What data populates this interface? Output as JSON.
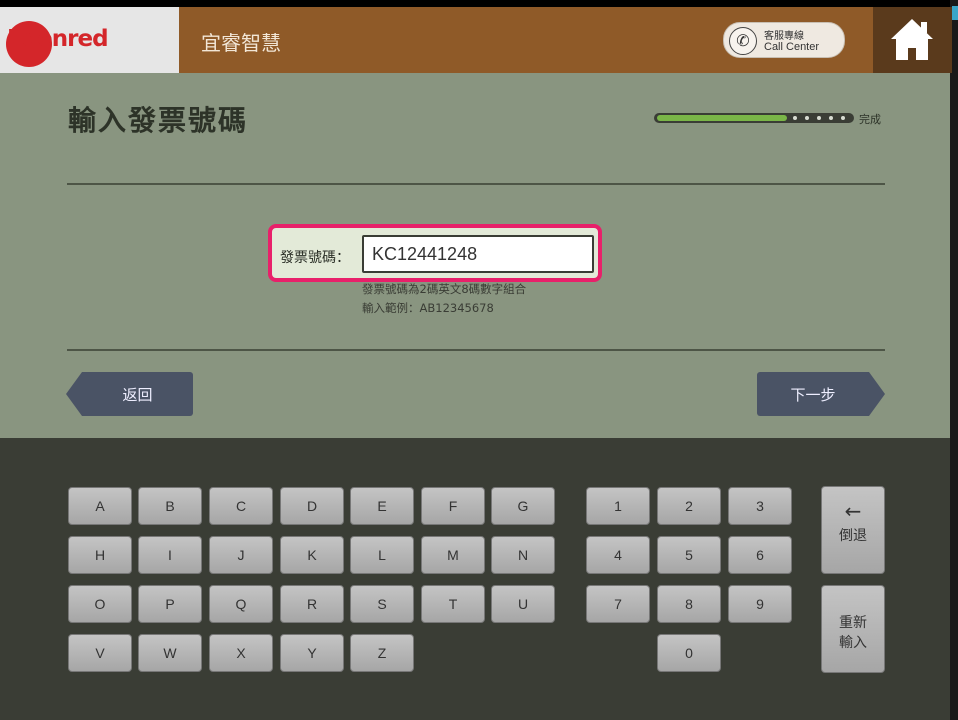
{
  "header": {
    "logo_text": "Edenred",
    "brand_title": "宜睿智慧",
    "call_center_zh": "客服專線",
    "call_center_en": "Call Center",
    "icons": {
      "call": "phone-icon",
      "home": "home-icon"
    }
  },
  "main": {
    "title": "輸入發票號碼",
    "progress_label": "完成",
    "progress_fraction": 0.67,
    "field_label": "發票號碼：",
    "field_value": "KC12441248",
    "hint_line1": "發票號碼為2碼英文8碼數字組合",
    "hint_line2": "輸入範例：AB12345678",
    "back_label": "返回",
    "next_label": "下一步"
  },
  "keyboard": {
    "letters": [
      [
        "A",
        "B",
        "C",
        "D",
        "E",
        "F",
        "G"
      ],
      [
        "H",
        "I",
        "J",
        "K",
        "L",
        "M",
        "N"
      ],
      [
        "O",
        "P",
        "Q",
        "R",
        "S",
        "T",
        "U"
      ],
      [
        "V",
        "W",
        "X",
        "Y",
        "Z"
      ]
    ],
    "digits": [
      [
        "1",
        "2",
        "3"
      ],
      [
        "4",
        "5",
        "6"
      ],
      [
        "7",
        "8",
        "9"
      ],
      [
        "0"
      ]
    ],
    "backspace_arrow": "←",
    "backspace_label": "倒退",
    "reset_label_line1": "重新",
    "reset_label_line2": "輸入"
  },
  "colors": {
    "accent_highlight": "#e8206a",
    "brand_bar": "#8f5a28",
    "logo_red": "#d4262a",
    "progress_green": "#7ab648"
  }
}
